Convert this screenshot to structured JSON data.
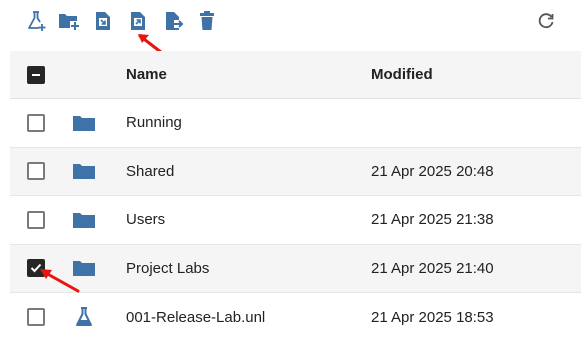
{
  "toolbar": {
    "buttons": [
      {
        "icon": "add-lab-icon"
      },
      {
        "icon": "add-folder-icon"
      },
      {
        "icon": "import-file-icon"
      },
      {
        "icon": "export-file-icon"
      },
      {
        "icon": "move-file-icon"
      },
      {
        "icon": "delete-icon"
      }
    ],
    "refresh_icon": "refresh-icon"
  },
  "table": {
    "header": {
      "name": "Name",
      "modified": "Modified",
      "select_all_state": "indeterminate"
    },
    "rows": [
      {
        "type": "folder",
        "name": "Running",
        "modified": "",
        "checked": false
      },
      {
        "type": "folder",
        "name": "Shared",
        "modified": "21 Apr 2025 20:48",
        "checked": false
      },
      {
        "type": "folder",
        "name": "Users",
        "modified": "21 Apr 2025 21:38",
        "checked": false
      },
      {
        "type": "folder",
        "name": "Project Labs",
        "modified": "21 Apr 2025 21:40",
        "checked": true
      },
      {
        "type": "lab",
        "name": "001-Release-Lab.unl",
        "modified": "21 Apr 2025 18:53",
        "checked": false
      }
    ]
  },
  "colors": {
    "icon_blue": "#3f73a8",
    "annotation_red": "#e8140e",
    "row_shade": "#f5f5f5"
  }
}
